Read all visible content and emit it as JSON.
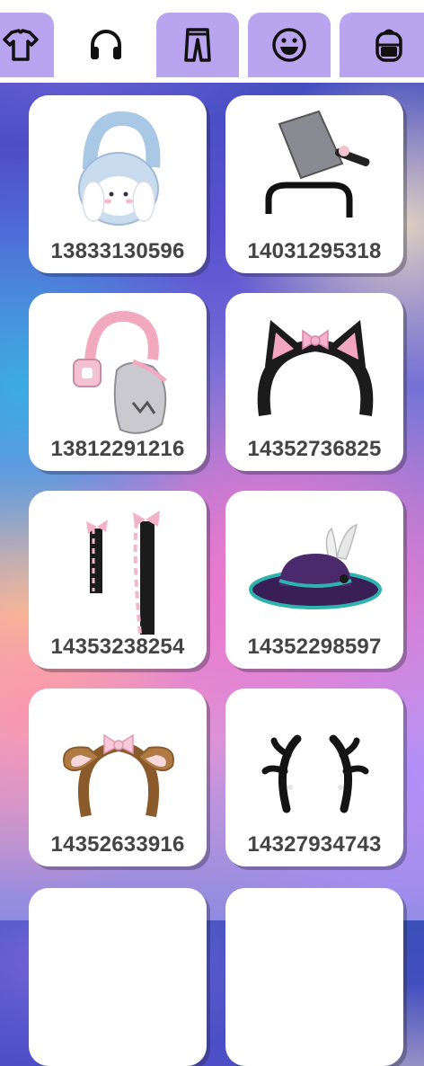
{
  "tabs": [
    {
      "name": "shirt-icon",
      "active": false
    },
    {
      "name": "headphones-icon",
      "active": true
    },
    {
      "name": "pants-icon",
      "active": false
    },
    {
      "name": "smile-icon",
      "active": false
    },
    {
      "name": "backpack-icon",
      "active": false
    }
  ],
  "colors": {
    "tab_inactive": "#b9a4f0",
    "tab_active": "#ffffff",
    "card": "#ffffff",
    "code_text": "#444444"
  },
  "items": [
    {
      "id": "13833130596",
      "art": "bunny-earmuffs"
    },
    {
      "id": "14031295318",
      "art": "cleaver-headband"
    },
    {
      "id": "13812291216",
      "art": "pink-headphones-bag"
    },
    {
      "id": "14352736825",
      "art": "black-cat-ears-headband"
    },
    {
      "id": "14353238254",
      "art": "ribbon-hair-ties"
    },
    {
      "id": "14352298597",
      "art": "purple-feather-hat"
    },
    {
      "id": "14352633916",
      "art": "brown-puppy-ears-headband"
    },
    {
      "id": "14327934743",
      "art": "black-antlers"
    }
  ]
}
